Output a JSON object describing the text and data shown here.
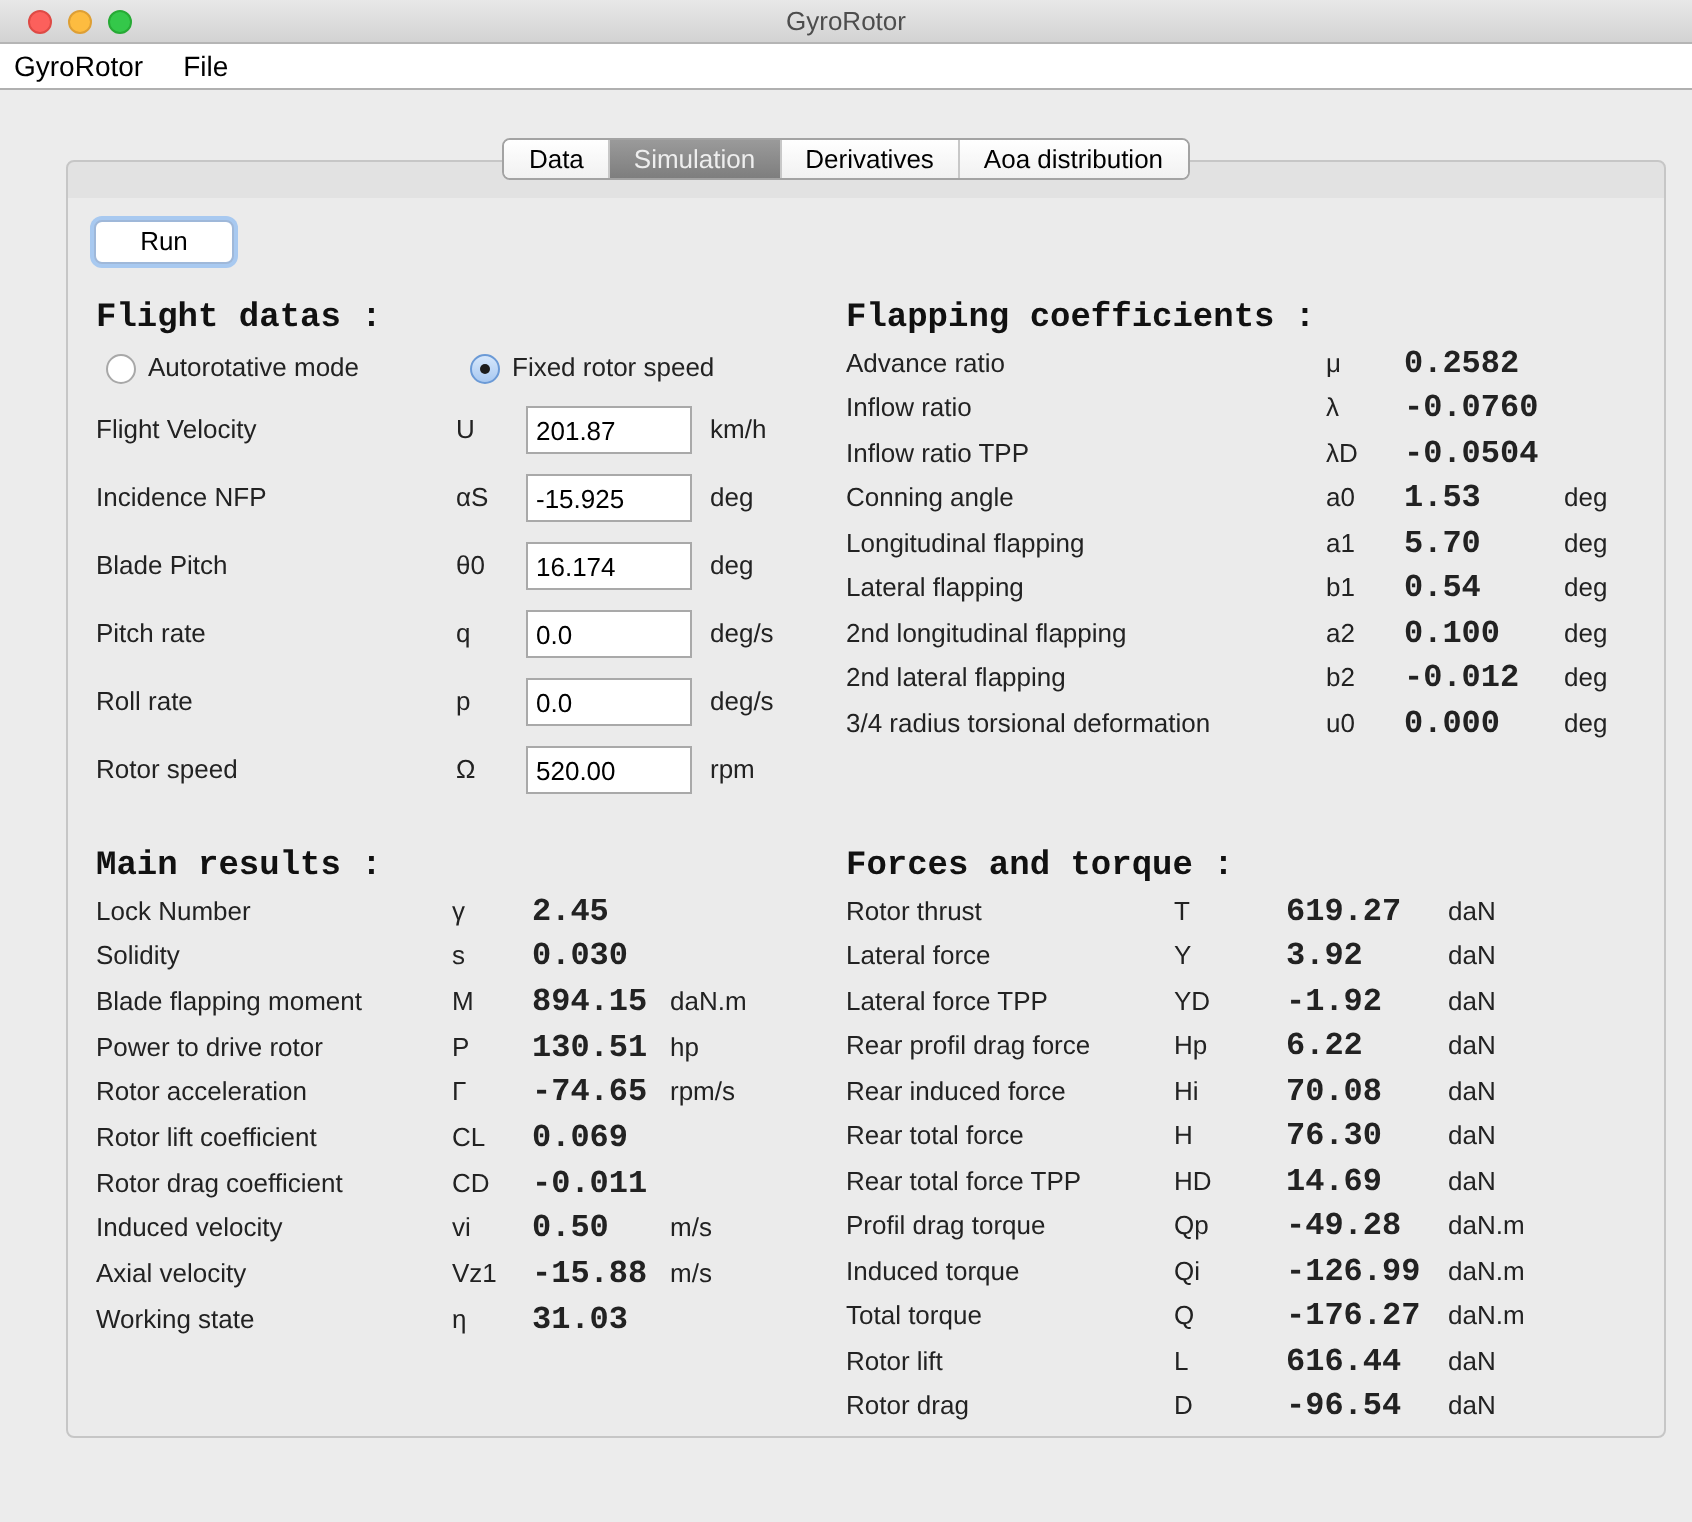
{
  "window": {
    "title": "GyroRotor"
  },
  "menu": [
    "GyroRotor",
    "File"
  ],
  "tabs": [
    {
      "label": "Data",
      "selected": false
    },
    {
      "label": "Simulation",
      "selected": true
    },
    {
      "label": "Derivatives",
      "selected": false
    },
    {
      "label": "Aoa distribution",
      "selected": false
    }
  ],
  "run_button": "Run",
  "flight_datas": {
    "title": "Flight datas :",
    "modes": [
      {
        "label": "Autorotative mode",
        "selected": false
      },
      {
        "label": "Fixed rotor speed",
        "selected": true
      }
    ],
    "fields": [
      {
        "label": "Flight Velocity",
        "symbol": "U",
        "value": "201.87",
        "unit": "km/h"
      },
      {
        "label": "Incidence NFP",
        "symbol": "αS",
        "value": "-15.925",
        "unit": "deg"
      },
      {
        "label": "Blade Pitch",
        "symbol": "θ0",
        "value": "16.174",
        "unit": "deg"
      },
      {
        "label": "Pitch rate",
        "symbol": "q",
        "value": "0.0",
        "unit": "deg/s"
      },
      {
        "label": "Roll rate",
        "symbol": "p",
        "value": "0.0",
        "unit": "deg/s"
      },
      {
        "label": "Rotor speed",
        "symbol": "Ω",
        "value": "520.00",
        "unit": "rpm"
      }
    ]
  },
  "flapping_coefficients": {
    "title": "Flapping coefficients :",
    "rows": [
      {
        "label": "Advance ratio",
        "symbol": "μ",
        "value": "0.2582"
      },
      {
        "label": "Inflow ratio",
        "symbol": "λ",
        "value": "-0.0760"
      },
      {
        "label": "Inflow ratio TPP",
        "symbol": "λD",
        "value": "-0.0504"
      },
      {
        "label": "Conning angle",
        "symbol": "a0",
        "value": "1.53",
        "unit": "deg"
      },
      {
        "label": "Longitudinal flapping",
        "symbol": "a1",
        "value": "5.70",
        "unit": "deg"
      },
      {
        "label": "Lateral flapping",
        "symbol": "b1",
        "value": "0.54",
        "unit": "deg"
      },
      {
        "label": "2nd longitudinal flapping",
        "symbol": "a2",
        "value": "0.100",
        "unit": "deg"
      },
      {
        "label": "2nd lateral flapping",
        "symbol": "b2",
        "value": "-0.012",
        "unit": "deg"
      },
      {
        "label": "3/4 radius torsional deformation",
        "symbol": "u0",
        "value": "0.000",
        "unit": "deg"
      }
    ]
  },
  "main_results": {
    "title": "Main results :",
    "rows": [
      {
        "label": "Lock Number",
        "symbol": "γ",
        "value": "2.45"
      },
      {
        "label": "Solidity",
        "symbol": "s",
        "value": "0.030"
      },
      {
        "label": "Blade flapping moment",
        "symbol": "M",
        "value": "894.15",
        "unit": "daN.m"
      },
      {
        "label": "Power to drive rotor",
        "symbol": "P",
        "value": "130.51",
        "unit": "hp"
      },
      {
        "label": "Rotor acceleration",
        "symbol": "Γ",
        "value": "-74.65",
        "unit": "rpm/s"
      },
      {
        "label": "Rotor lift coefficient",
        "symbol": "CL",
        "value": "0.069"
      },
      {
        "label": "Rotor drag coefficient",
        "symbol": "CD",
        "value": "-0.011"
      },
      {
        "label": "Induced velocity",
        "symbol": "vi",
        "value": "0.50",
        "unit": "m/s"
      },
      {
        "label": "Axial velocity",
        "symbol": "Vz1",
        "value": "-15.88",
        "unit": "m/s"
      },
      {
        "label": "Working state",
        "symbol": "η",
        "value": "31.03"
      }
    ]
  },
  "forces_and_torque": {
    "title": "Forces and torque :",
    "rows": [
      {
        "label": "Rotor thrust",
        "symbol": "T",
        "value": "619.27",
        "unit": "daN"
      },
      {
        "label": "Lateral force",
        "symbol": "Y",
        "value": "3.92",
        "unit": "daN"
      },
      {
        "label": "Lateral force TPP",
        "symbol": "YD",
        "value": "-1.92",
        "unit": "daN"
      },
      {
        "label": "Rear profil drag force",
        "symbol": "Hp",
        "value": "6.22",
        "unit": "daN"
      },
      {
        "label": "Rear induced force",
        "symbol": "Hi",
        "value": "70.08",
        "unit": "daN"
      },
      {
        "label": "Rear total force",
        "symbol": "H",
        "value": "76.30",
        "unit": "daN"
      },
      {
        "label": "Rear total force TPP",
        "symbol": "HD",
        "value": "14.69",
        "unit": "daN"
      },
      {
        "label": "Profil drag torque",
        "symbol": "Qp",
        "value": "-49.28",
        "unit": "daN.m"
      },
      {
        "label": "Induced torque",
        "symbol": "Qi",
        "value": "-126.99",
        "unit": "daN.m"
      },
      {
        "label": "Total torque",
        "symbol": "Q",
        "value": "-176.27",
        "unit": "daN.m"
      },
      {
        "label": "Rotor lift",
        "symbol": "L",
        "value": "616.44",
        "unit": "daN"
      },
      {
        "label": "Rotor drag",
        "symbol": "D",
        "value": "-96.54",
        "unit": "daN"
      }
    ]
  }
}
